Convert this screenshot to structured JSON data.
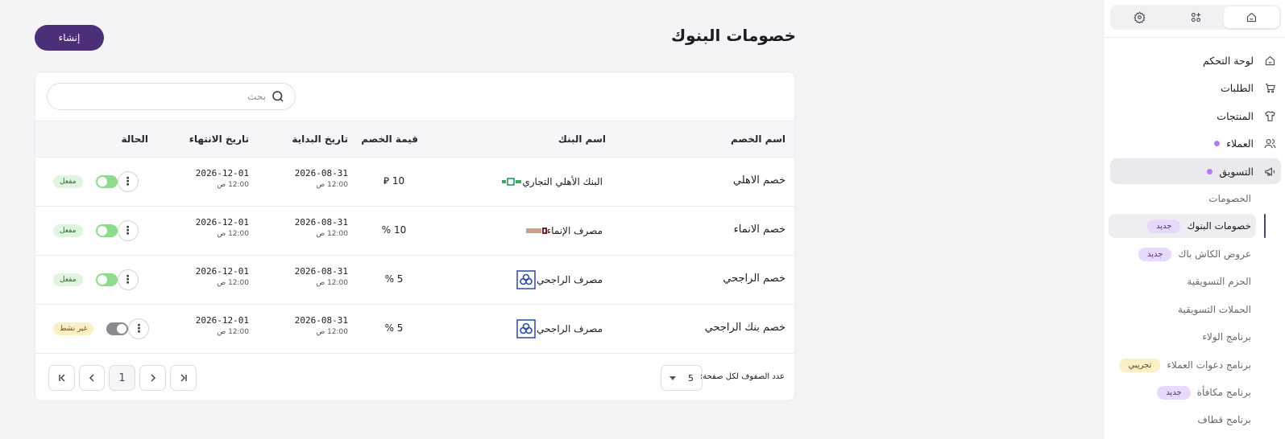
{
  "page": {
    "title": "خصومات البنوك",
    "create_label": "إنشاء"
  },
  "search": {
    "placeholder": "بحث"
  },
  "table": {
    "headers": {
      "discount_name": "اسم الخصم",
      "bank_name": "اسم البنك",
      "discount_value": "قيمة الخصم",
      "start_date": "تاريخ البداية",
      "end_date": "تاريخ الانتهاء",
      "status": "الحالة"
    },
    "rows": [
      {
        "name": "خصم الاهلي",
        "bank": "البنك الأهلي التجاري",
        "bank_logo": "alahli-logo",
        "value": "10 ⃁",
        "start_date": "2026-08-31",
        "start_time": "12:00 ص",
        "end_date": "2026-12-01",
        "end_time": "12:00 ص",
        "status": "مفعل",
        "enabled": true
      },
      {
        "name": "خصم الانماء",
        "bank": "مصرف الإنماء",
        "bank_logo": "alinma-logo",
        "value": "10 %",
        "start_date": "2026-08-31",
        "start_time": "12:00 ص",
        "end_date": "2026-12-01",
        "end_time": "12:00 ص",
        "status": "مفعل",
        "enabled": true
      },
      {
        "name": "خصم الراجحي",
        "bank": "مصرف الراجحي",
        "bank_logo": "alrajhi-logo",
        "value": "5 %",
        "start_date": "2026-08-31",
        "start_time": "12:00 ص",
        "end_date": "2026-12-01",
        "end_time": "12:00 ص",
        "status": "مفعل",
        "enabled": true
      },
      {
        "name": "خصم بنك الراجحي",
        "bank": "مصرف الراجحي",
        "bank_logo": "alrajhi-logo",
        "value": "5 %",
        "start_date": "2026-08-31",
        "start_time": "12:00 ص",
        "end_date": "2026-12-01",
        "end_time": "12:00 ص",
        "status": "غير نشط",
        "enabled": false
      }
    ]
  },
  "pagination": {
    "rows_per_page_label": "عدد الصفوف لكل صفحة:",
    "rows_per_page": "5",
    "current_page": "1"
  },
  "sidebar": {
    "tabs": [
      "home-icon",
      "apps-icon",
      "settings-icon"
    ],
    "items": [
      {
        "label": "لوحة التحكم",
        "icon": "home-icon"
      },
      {
        "label": "الطلبات",
        "icon": "cart-icon"
      },
      {
        "label": "المنتجات",
        "icon": "shirt-icon"
      },
      {
        "label": "العملاء",
        "icon": "users-icon"
      },
      {
        "label": "التسويق",
        "icon": "megaphone-icon"
      }
    ],
    "marketing_sub": [
      {
        "label": "الخصومات"
      },
      {
        "label": "خصومات البنوك",
        "badge": "جديد"
      },
      {
        "label": "عروض الكاش باك",
        "badge": "جديد"
      },
      {
        "label": "الحزم التسويقية"
      },
      {
        "label": "الحملات التسويقية"
      },
      {
        "label": "برنامج الولاء"
      },
      {
        "label": "برنامج دعوات العملاء",
        "badge": "تجريبي"
      },
      {
        "label": "برنامج مكافأة",
        "badge": "جديد"
      },
      {
        "label": "برنامج قطاف"
      }
    ]
  },
  "colors": {
    "primary": "#4b2f78",
    "accent_dot": "#b47cf0",
    "toggle_on": "#8edb8e"
  }
}
